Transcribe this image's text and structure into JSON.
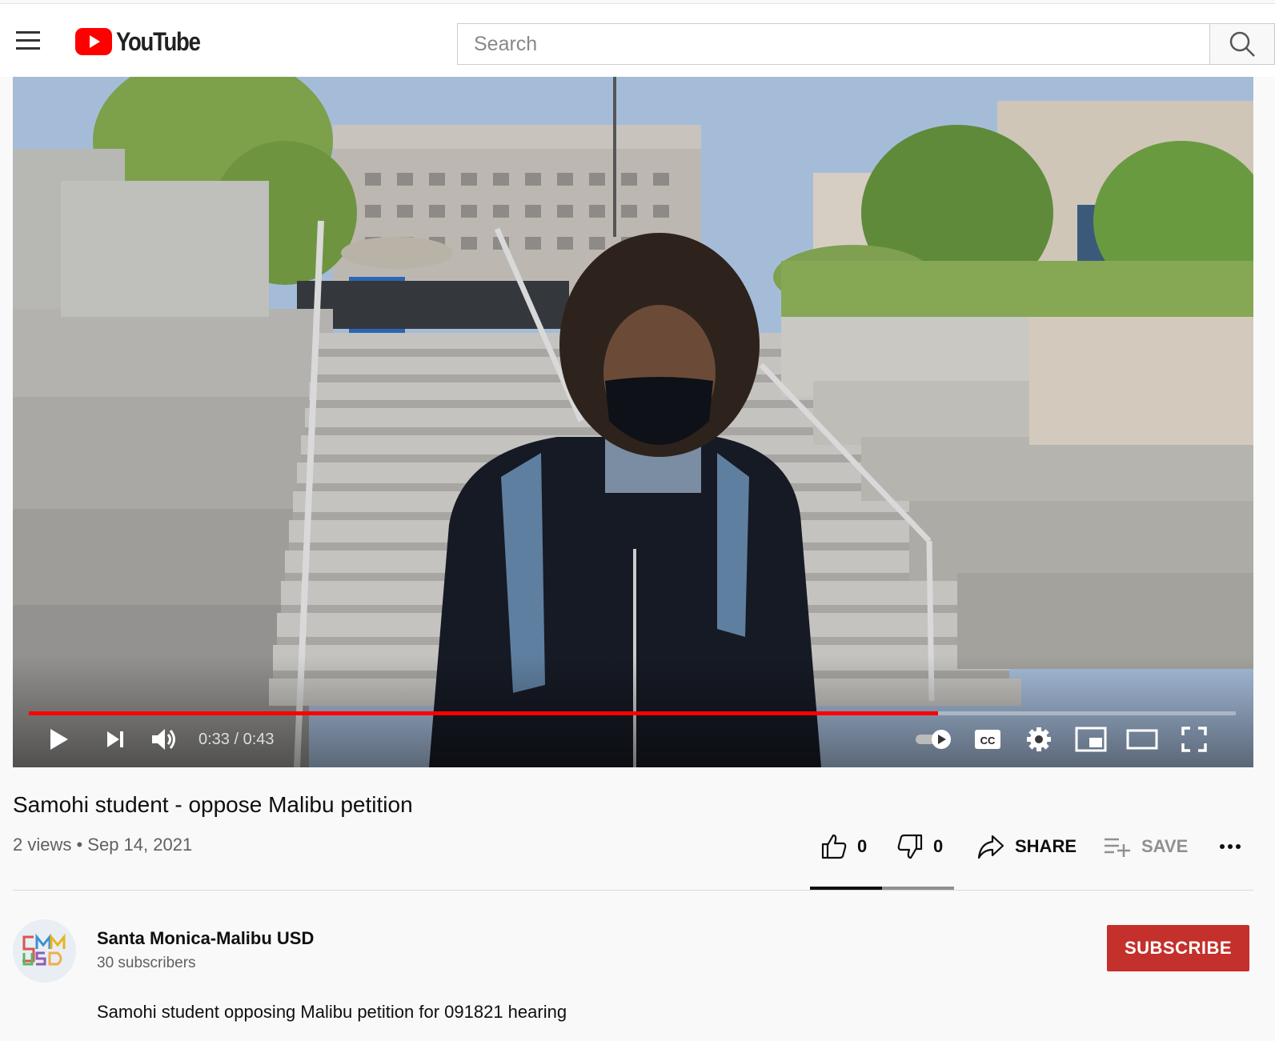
{
  "masthead": {
    "logo_text": "YouTube",
    "search": {
      "placeholder": "Search",
      "value": ""
    },
    "icons": [
      "menu-icon",
      "youtube-logo-icon",
      "search-icon"
    ]
  },
  "player": {
    "current_time": "0:33",
    "duration": "0:43",
    "time_display": "0:33 / 0:43",
    "progress_fraction": 0.753,
    "autoplay_on": true,
    "icons": [
      "play-icon",
      "next-icon",
      "volume-icon",
      "autoplay-toggle-icon",
      "captions-icon",
      "settings-icon",
      "miniplayer-icon",
      "theater-mode-icon",
      "fullscreen-icon"
    ]
  },
  "video": {
    "title": "Samohi student - oppose Malibu petition",
    "views": "2 views",
    "date": "Sep 14, 2021",
    "meta_line": "2 views • Sep 14, 2021",
    "likes": "0",
    "dislikes": "0",
    "share_label": "SHARE",
    "save_label": "SAVE",
    "like_fraction": 0.5
  },
  "channel": {
    "name": "Santa Monica-Malibu USD",
    "subscribers": "30 subscribers",
    "subscribe_label": "SUBSCRIBE",
    "avatar_letters": "SMMUSD",
    "description": "Samohi student opposing Malibu petition for 091821 hearing"
  },
  "colors": {
    "brand_red": "#ff0000",
    "subscribe_red": "#c4302b",
    "text_primary": "#0f0f0f",
    "text_secondary": "#606060"
  }
}
